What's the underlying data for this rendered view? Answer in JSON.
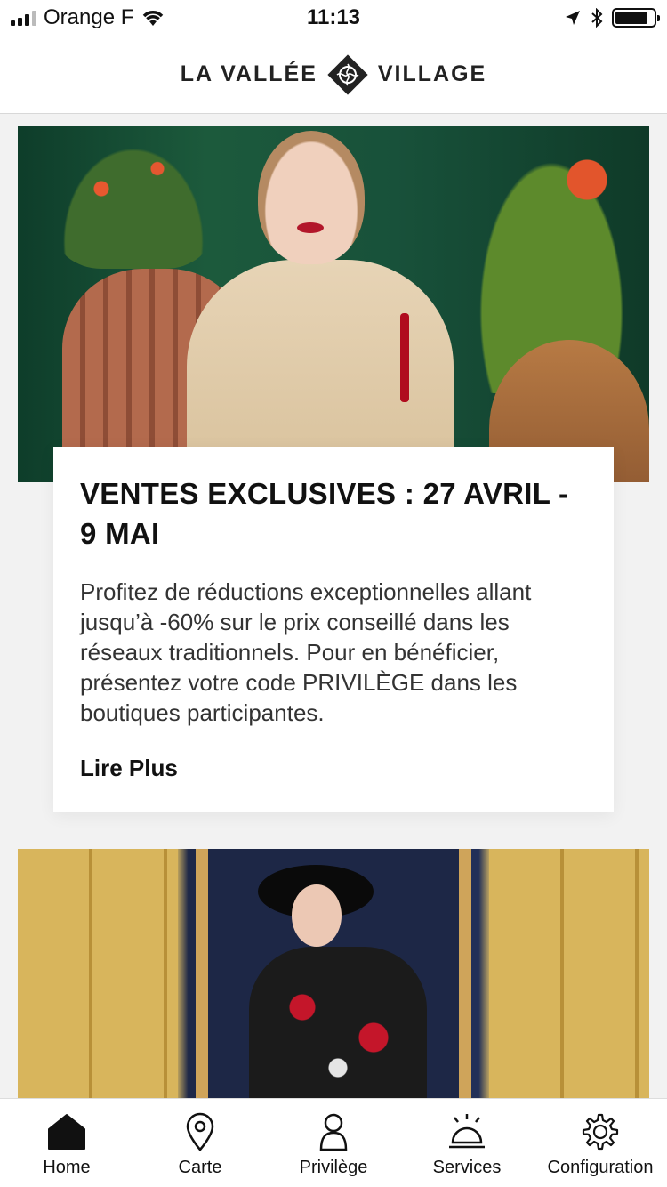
{
  "status_bar": {
    "carrier": "Orange F",
    "time": "11:13",
    "battery_level": 0.85
  },
  "header": {
    "brand_left": "LA VALLÉE",
    "brand_right": "VILLAGE",
    "logo_icon": "ornament-logo-icon"
  },
  "card": {
    "title": "VENTES EXCLUSIVES : 27 AVRIL - 9 MAI",
    "body": "Profitez de réductions exceptionnelles allant jusqu’à -60% sur le prix conseillé dans les réseaux traditionnels. Pour en bénéficier, présentez votre code PRIVILÈGE dans les boutiques participantes.",
    "read_more": "Lire Plus"
  },
  "tabs": [
    {
      "label": "Home",
      "icon": "home-icon",
      "active": true
    },
    {
      "label": "Carte",
      "icon": "map-pin-icon",
      "active": false
    },
    {
      "label": "Privilège",
      "icon": "person-icon",
      "active": false
    },
    {
      "label": "Services",
      "icon": "service-bell-icon",
      "active": false
    },
    {
      "label": "Configuration",
      "icon": "gear-icon",
      "active": false
    }
  ],
  "colors": {
    "background": "#f2f2f2",
    "text": "#111111",
    "card": "#ffffff"
  }
}
